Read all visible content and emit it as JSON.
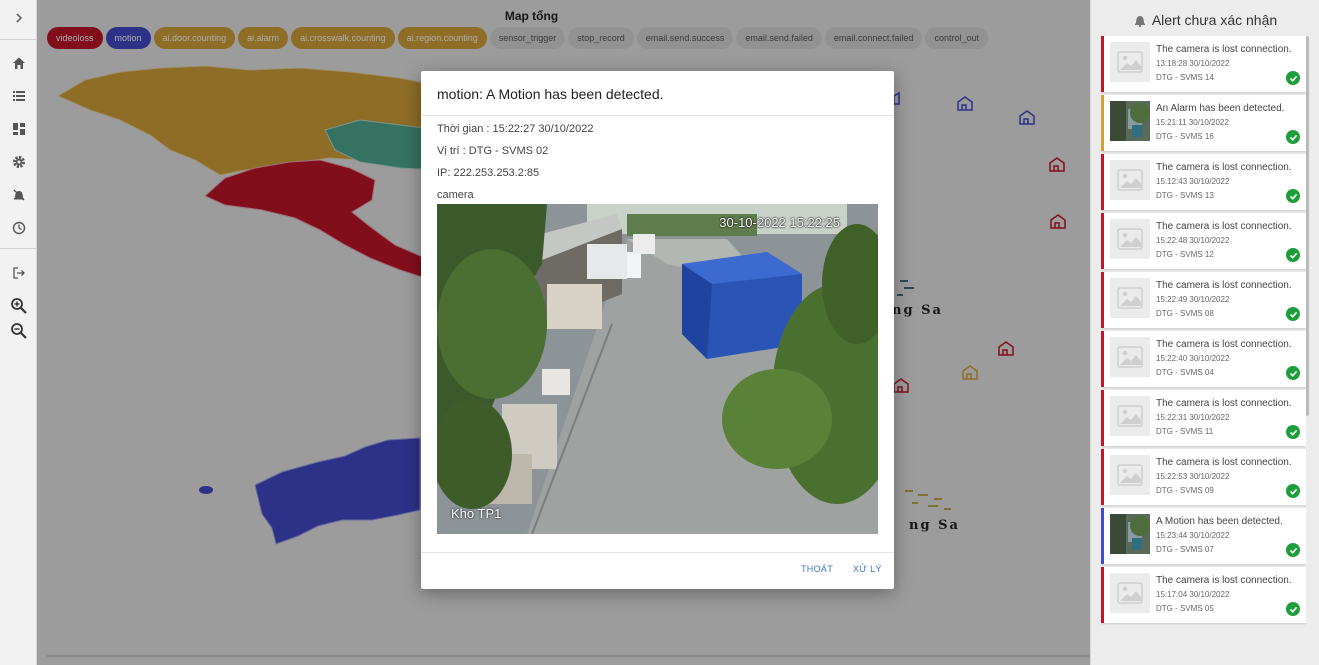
{
  "map": {
    "title": "Map tổng",
    "filters": [
      {
        "label": "videoloss",
        "color": "red"
      },
      {
        "label": "motion",
        "color": "blue"
      },
      {
        "label": "ai.door.counting",
        "color": "orange"
      },
      {
        "label": "ai.alarm",
        "color": "orange"
      },
      {
        "label": "ai.crosswalk.counting",
        "color": "orange"
      },
      {
        "label": "ai.region.counting",
        "color": "orange"
      },
      {
        "label": "sensor_trigger",
        "color": "grey"
      },
      {
        "label": "stop_record",
        "color": "grey"
      },
      {
        "label": "email.send.success",
        "color": "grey"
      },
      {
        "label": "email.send.failed",
        "color": "grey"
      },
      {
        "label": "email.connect.failed",
        "color": "grey"
      },
      {
        "label": "control_out",
        "color": "grey"
      }
    ],
    "map_labels": [
      "ng Sa",
      "ng Sa"
    ]
  },
  "sidebar": {
    "icons": [
      "chevron-right-icon",
      "home-icon",
      "list-icon",
      "dashboard-icon",
      "settings-icon",
      "alarm-off-icon",
      "clock-icon",
      "logout-icon",
      "zoom-in-icon",
      "zoom-out-icon"
    ]
  },
  "dialog": {
    "title": "motion: A Motion has been detected.",
    "time": "Thời gian : 15:22:27 30/10/2022",
    "location": "Vị trí : DTG - SVMS 02",
    "ip": "IP: 222.253.253.2:85",
    "image_caption": "camera",
    "camera_timestamp": "30-10-2022 15:22:25",
    "camera_label": "Kho TP1",
    "cancel_label": "THOÁT",
    "process_label": "XỬ LÝ"
  },
  "alerts": {
    "title": "Alert chưa xác nhận",
    "items": [
      {
        "message": "The camera is lost connection.",
        "time": "13:18:28 30/10/2022",
        "location": "DTG - SVMS 14",
        "color": "red",
        "thumb": "placeholder"
      },
      {
        "message": "An Alarm has been detected.",
        "time": "15:21:11 30/10/2022",
        "location": "DTG - SVMS 16",
        "color": "orange",
        "thumb": "photo"
      },
      {
        "message": "The camera is lost connection.",
        "time": "15:12:43 30/10/2022",
        "location": "DTG - SVMS 13",
        "color": "red",
        "thumb": "placeholder"
      },
      {
        "message": "The camera is lost connection.",
        "time": "15:22:48 30/10/2022",
        "location": "DTG - SVMS 12",
        "color": "red",
        "thumb": "placeholder"
      },
      {
        "message": "The camera is lost connection.",
        "time": "15:22:49 30/10/2022",
        "location": "DTG - SVMS 08",
        "color": "red",
        "thumb": "placeholder"
      },
      {
        "message": "The camera is lost connection.",
        "time": "15:22:40 30/10/2022",
        "location": "DTG - SVMS 04",
        "color": "red",
        "thumb": "placeholder"
      },
      {
        "message": "The camera is lost connection.",
        "time": "15:22:31 30/10/2022",
        "location": "DTG - SVMS 11",
        "color": "red",
        "thumb": "placeholder"
      },
      {
        "message": "The camera is lost connection.",
        "time": "15:22:53 30/10/2022",
        "location": "DTG - SVMS 09",
        "color": "red",
        "thumb": "placeholder"
      },
      {
        "message": "A Motion has been detected.",
        "time": "15:23:44 30/10/2022",
        "location": "DTG - SVMS 07",
        "color": "blue",
        "thumb": "photo"
      },
      {
        "message": "The camera is lost connection.",
        "time": "15:17:04 30/10/2022",
        "location": "DTG - SVMS 05",
        "color": "red",
        "thumb": "placeholder"
      }
    ]
  },
  "colors": {
    "videoloss": "#c0152a",
    "motion": "#4349c7",
    "ai": "#d1a13a",
    "accent": "#3a76c8",
    "confirmed": "#1e9e3a"
  }
}
